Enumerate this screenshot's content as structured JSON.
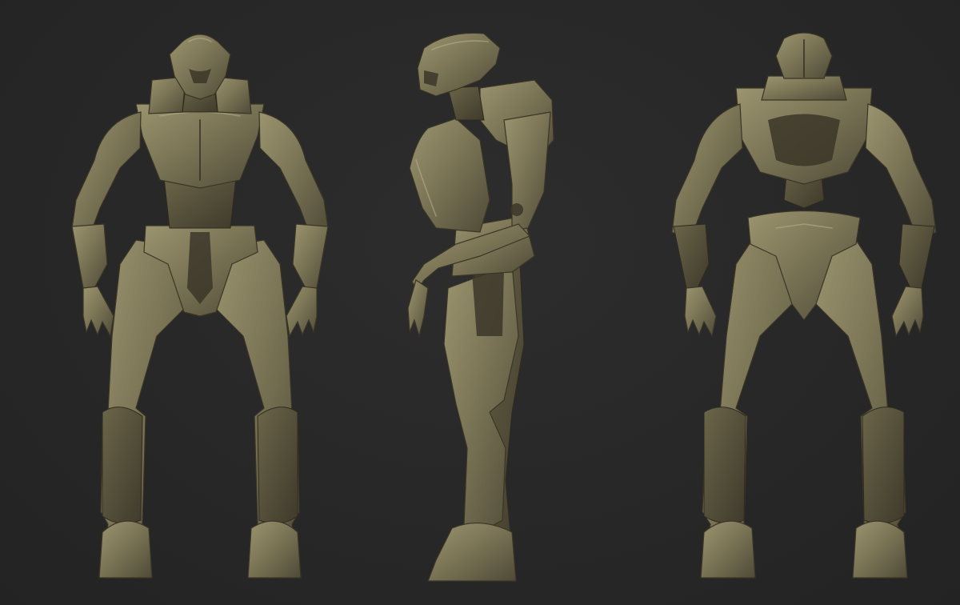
{
  "scene": {
    "background_color": "#272727",
    "material_color": "#7d7758",
    "views": [
      {
        "name": "front-view"
      },
      {
        "name": "side-view"
      },
      {
        "name": "back-view"
      }
    ]
  }
}
